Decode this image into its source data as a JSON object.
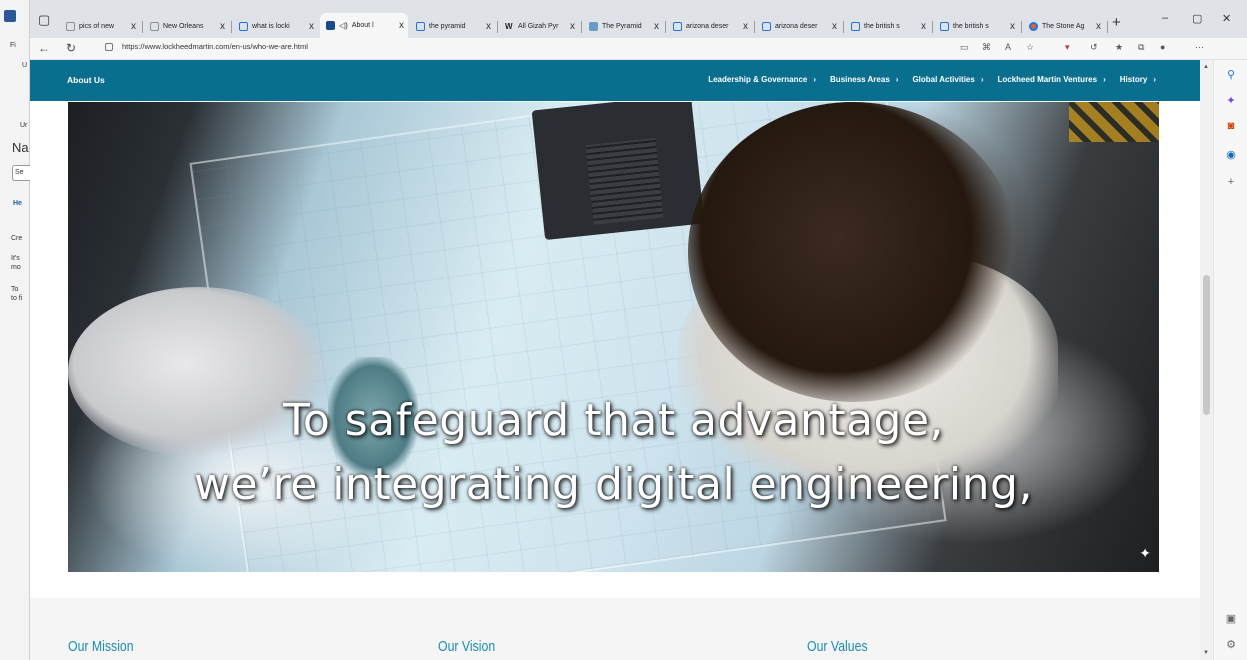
{
  "background_window": {
    "lines": [
      "Fi",
      "U",
      "Ur",
      "Na",
      "Se",
      "He",
      "Cre",
      "It's",
      "mo",
      "To",
      "to fi"
    ]
  },
  "browser": {
    "tabs": [
      {
        "label": "pics of new",
        "icon": "search-icon",
        "color": "#8a8f95"
      },
      {
        "label": "New Orleans",
        "icon": "search-icon",
        "color": "#8a8f95"
      },
      {
        "label": "what is locki",
        "icon": "search-icon",
        "color": "#1a73e8"
      },
      {
        "label": "About l",
        "icon": "lockheed-icon",
        "color": "#1a4a8a",
        "active": true,
        "audio": "speaker-icon"
      },
      {
        "label": "the pyramid",
        "icon": "search-icon",
        "color": "#1a73e8"
      },
      {
        "label": "All Gizah Pyr",
        "icon": "wikipedia-icon",
        "color": "#333"
      },
      {
        "label": "The Pyramid",
        "icon": "page-icon",
        "color": "#6a9bc8"
      },
      {
        "label": "arizona deser",
        "icon": "search-icon",
        "color": "#1a73e8"
      },
      {
        "label": "arizona deser",
        "icon": "search-icon",
        "color": "#1a73e8"
      },
      {
        "label": "the british s",
        "icon": "search-icon",
        "color": "#1a73e8"
      },
      {
        "label": "the british s",
        "icon": "search-icon",
        "color": "#1a73e8"
      },
      {
        "label": "The Stone Ag",
        "icon": "record-icon",
        "color": "#1a73e8"
      }
    ],
    "new_tab": "+",
    "close_tab": "x",
    "window": {
      "minimize": "–",
      "maximize": "▢",
      "close": "✕"
    },
    "url": "https://www.lockheedmartin.com/en-us/who-we-are.html"
  },
  "page": {
    "nav_title": "About Us",
    "nav_items": [
      {
        "label": "Leadership & Governance"
      },
      {
        "label": "Business Areas"
      },
      {
        "label": "Global Activities"
      },
      {
        "label": "Lockheed Martin Ventures"
      },
      {
        "label": "History"
      }
    ],
    "chevron": "›",
    "hero": {
      "caption_line1": "To safeguard that advantage,",
      "caption_line2": "we’re integrating digital engineering,"
    },
    "sections": [
      "Our Mission",
      "Our Vision",
      "Our Values"
    ]
  },
  "colors": {
    "nav_bg": "#0a6f8f",
    "section_heading": "#1b8db3"
  }
}
